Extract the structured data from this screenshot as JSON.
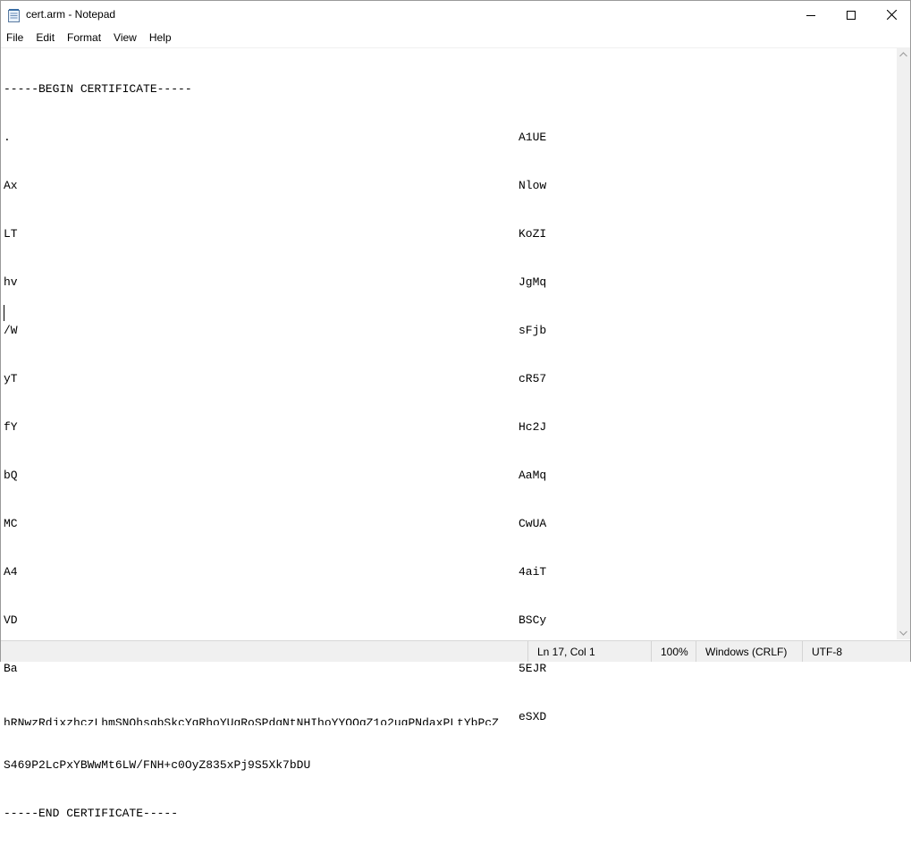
{
  "window": {
    "title": "cert.arm - Notepad",
    "icon": "notepad-icon"
  },
  "menu": [
    "File",
    "Edit",
    "Format",
    "View",
    "Help"
  ],
  "editor": {
    "begin": "-----BEGIN CERTIFICATE-----",
    "rows": [
      {
        "left": ".",
        "right": "A1UE"
      },
      {
        "left": "Ax",
        "right": "Nlow"
      },
      {
        "left": "LT",
        "right": "KoZI"
      },
      {
        "left": "hv",
        "right": "JgMq"
      },
      {
        "left": "/W",
        "right": "sFjb"
      },
      {
        "left": "yT",
        "right": "cR57"
      },
      {
        "left": "fY",
        "right": "Hc2J"
      },
      {
        "left": "bQ",
        "right": "AaMq"
      },
      {
        "left": "MC",
        "right": "CwUA"
      },
      {
        "left": "A4",
        "right": "4aiT"
      },
      {
        "left": "VD",
        "right": "BSCy"
      },
      {
        "left": "Ba",
        "right": "5EJR"
      }
    ],
    "partial_line": {
      "left": "hRNwzRdjxzhczLhmSNQhsgbSkcYqRhoYUgRoSPdgNtNHIhoYYQQgZ1o2ugPNdaxPLtYbPcZ",
      "right": "eSXD"
    },
    "last_data_line": "S469P2LcPxYBWwMt6LW/FNH+c0OyZ835xPj9S5Xk7bDU",
    "end": "-----END CERTIFICATE-----"
  },
  "status": {
    "position": "Ln 17, Col 1",
    "zoom": "100%",
    "line_endings": "Windows (CRLF)",
    "encoding": "UTF-8"
  }
}
